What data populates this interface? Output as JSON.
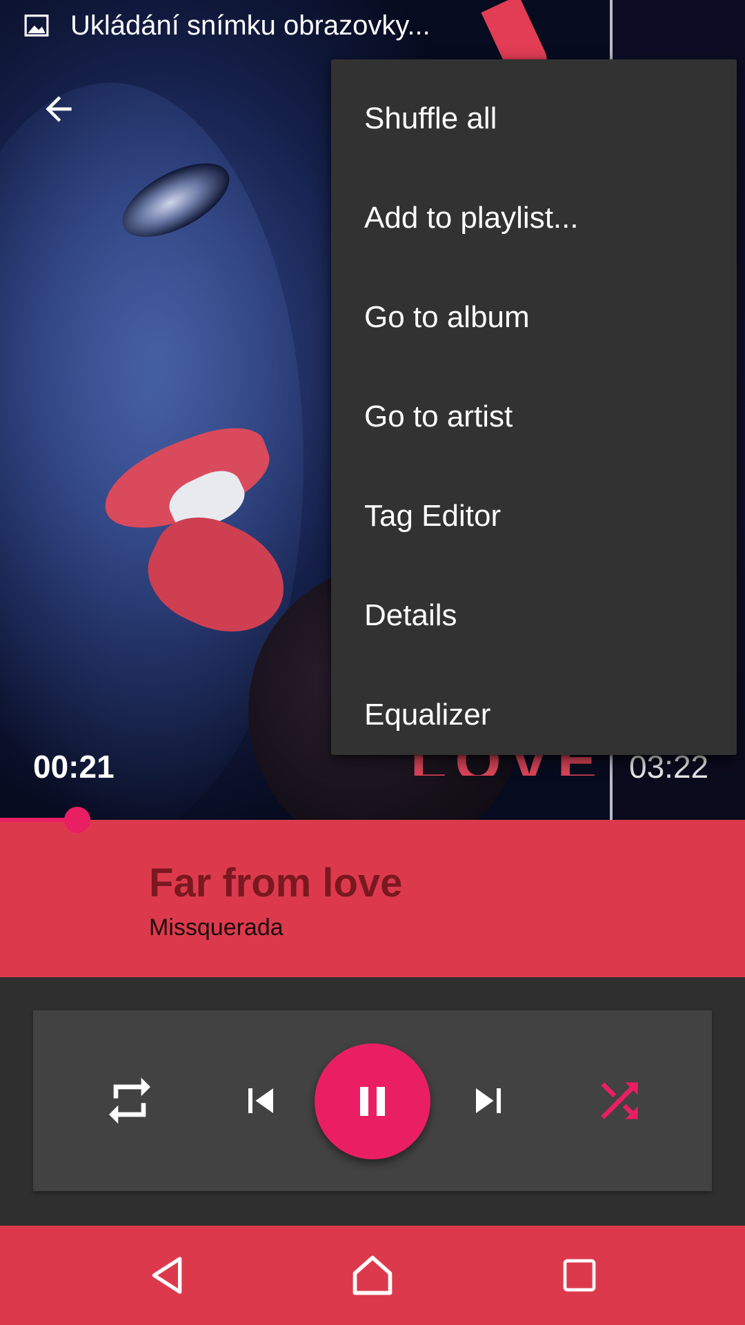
{
  "status_bar": {
    "notification_icon": "image-icon",
    "text": "Ukládání snímku obrazovky..."
  },
  "toolbar": {
    "back_icon": "arrow-back-icon"
  },
  "album_art": {
    "text": "LOVE"
  },
  "playback": {
    "elapsed": "00:21",
    "total": "03:22",
    "progress_fraction": 0.104
  },
  "song": {
    "title": "Far from love",
    "artist": "Missquerada"
  },
  "controls": {
    "repeat_icon": "repeat-icon",
    "previous_icon": "skip-previous-icon",
    "play_pause_icon": "pause-icon",
    "next_icon": "skip-next-icon",
    "shuffle_icon": "shuffle-icon"
  },
  "menu": {
    "items": [
      "Shuffle all",
      "Add to playlist...",
      "Go to album",
      "Go to artist",
      "Tag Editor",
      "Details",
      "Equalizer"
    ]
  },
  "nav_bar": {
    "back_icon": "nav-back-icon",
    "home_icon": "nav-home-icon",
    "recents_icon": "nav-recents-icon"
  },
  "colors": {
    "accent": "#e91e63",
    "band": "#dc3a4c",
    "menu_background": "#323232",
    "controls_card": "#424242"
  }
}
